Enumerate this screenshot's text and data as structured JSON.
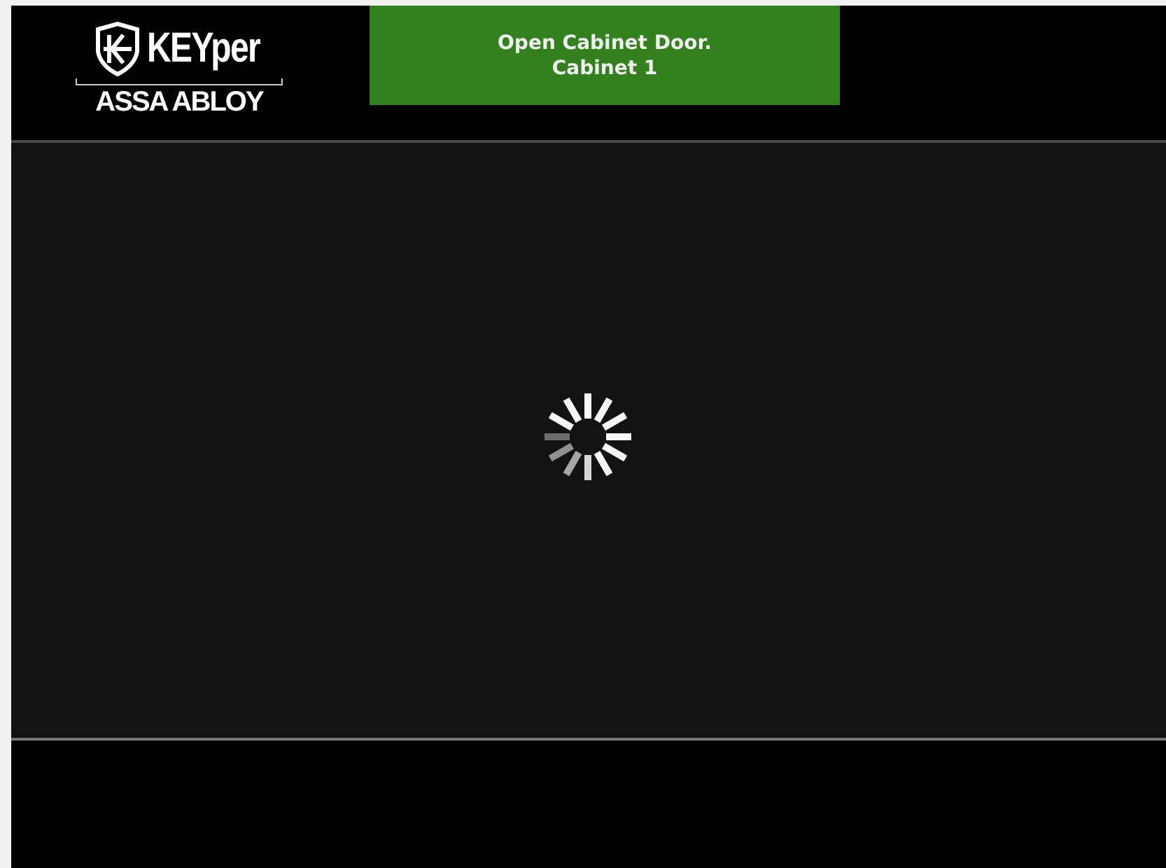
{
  "logo": {
    "brand": "KEYper",
    "company": "ASSA ABLOY"
  },
  "banner": {
    "lines": [
      "Open Cabinet Door.",
      "Cabinet 1"
    ]
  }
}
